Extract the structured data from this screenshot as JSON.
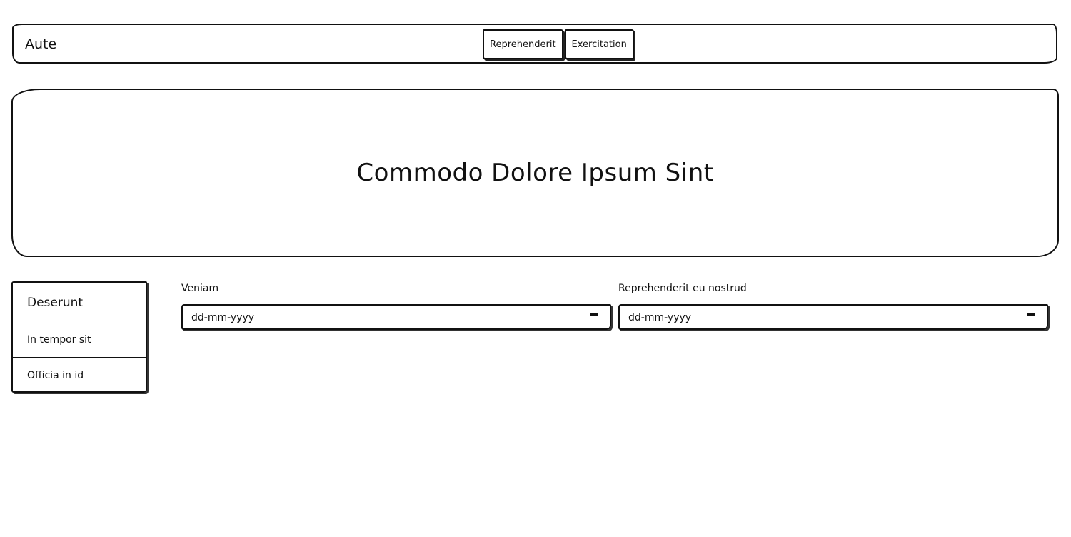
{
  "navbar": {
    "brand": "Aute",
    "buttons": [
      {
        "label": "Reprehenderit"
      },
      {
        "label": "Exercitation"
      }
    ]
  },
  "hero": {
    "title": "Commodo Dolore Ipsum Sint"
  },
  "sidebar": {
    "title": "Deserunt",
    "items": [
      {
        "label": "In tempor sit"
      },
      {
        "label": "Officia in id"
      }
    ]
  },
  "form": {
    "fields": [
      {
        "label": "Veniam",
        "placeholder": "dd-mm-yyyy",
        "icon": "calendar-icon"
      },
      {
        "label": "Reprehenderit eu nostrud",
        "placeholder": "dd-mm-yyyy",
        "icon": "calendar-icon"
      }
    ]
  }
}
